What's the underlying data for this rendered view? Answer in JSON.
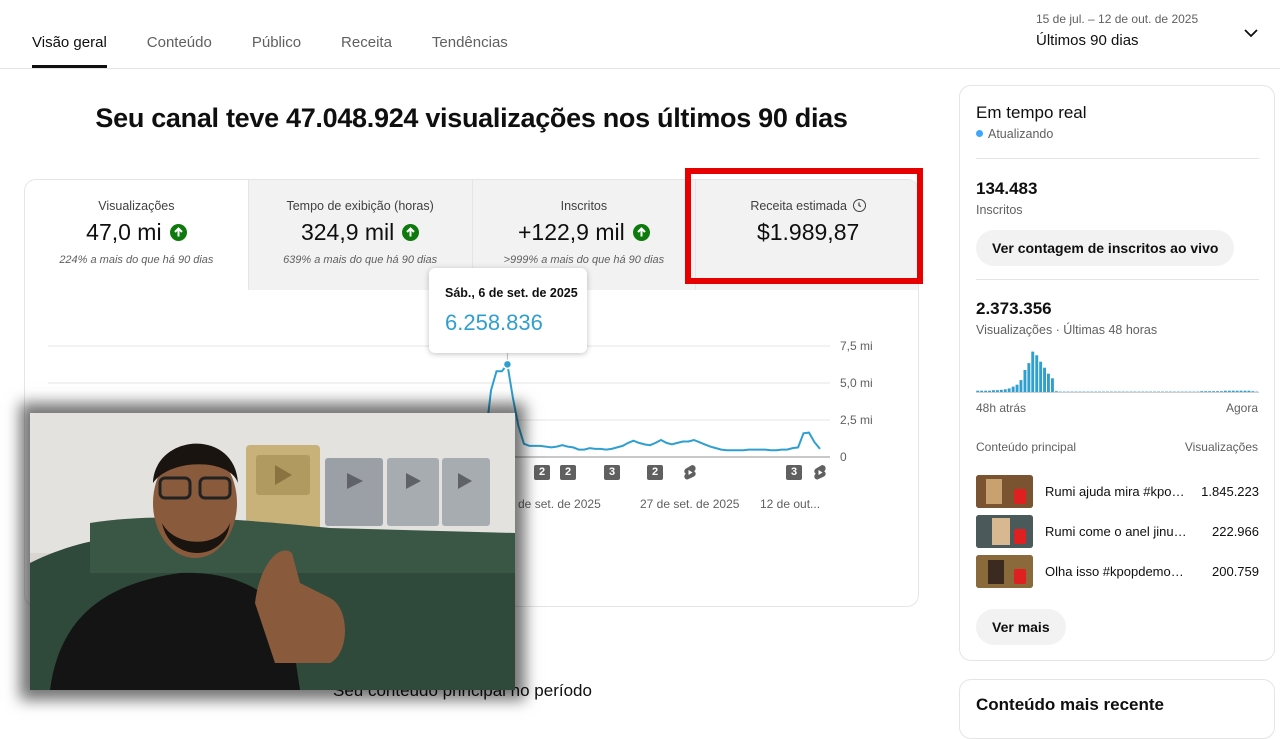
{
  "tabs": [
    "Visão geral",
    "Conteúdo",
    "Público",
    "Receita",
    "Tendências"
  ],
  "period": {
    "range": "15 de jul. – 12 de out. de 2025",
    "label": "Últimos 90 dias"
  },
  "headline": "Seu canal teve 47.048.924 visualizações nos últimos 90 dias",
  "metrics": [
    {
      "title": "Visualizações",
      "value": "47,0 mi",
      "comparison": "224% a mais do que há 90 dias"
    },
    {
      "title": "Tempo de exibição (horas)",
      "value": "324,9 mil",
      "comparison": "639% a mais do que há 90 dias"
    },
    {
      "title": "Inscritos",
      "value": "+122,9 mil",
      "comparison": ">999% a mais do que há 90 dias"
    },
    {
      "title": "Receita estimada",
      "value": "$1.989,87"
    }
  ],
  "tooltip": {
    "date": "Sáb., 6 de set. de 2025",
    "value": "6.258.836"
  },
  "chart_data": {
    "type": "line",
    "y_ticks": [
      "7,5 mi",
      "5,0 mi",
      "2,5 mi",
      "0"
    ],
    "ylim": [
      0,
      7.5
    ],
    "x_ticks": [
      "2 de set. de 2025",
      "27 de set. de 2025",
      "12 de out..."
    ],
    "series": [
      {
        "values": [
          0.3,
          1.3,
          4.5,
          5.8,
          5.8,
          6.26,
          4.0,
          2.1,
          0.9,
          0.75,
          0.75,
          0.75,
          0.7,
          0.65,
          0.7,
          0.8,
          0.7,
          0.65,
          0.5,
          0.5,
          0.6,
          0.55,
          0.55,
          0.5,
          0.55,
          0.65,
          0.75,
          0.95,
          1.1,
          0.95,
          0.85,
          0.8,
          0.95,
          1.15,
          0.95,
          0.85,
          0.95,
          1.05,
          1.05,
          1.15,
          1.0,
          0.85,
          0.7,
          0.6,
          0.5,
          0.45,
          0.45,
          0.45,
          0.45,
          0.5,
          0.5,
          0.5,
          0.5,
          0.45,
          0.45,
          0.5,
          0.5,
          0.6,
          0.65,
          1.6,
          1.65,
          1.0,
          0.55
        ]
      }
    ],
    "badges": [
      "2",
      "2",
      "3",
      "2",
      "3"
    ]
  },
  "section_title": "Seu conteúdo principal no período",
  "realtime": {
    "title": "Em tempo real",
    "status": "Atualizando",
    "subscribers_value": "134.483",
    "subscribers_label": "Inscritos",
    "live_button": "Ver contagem de inscritos ao vivo",
    "views_value": "2.373.356",
    "views_label": "Visualizações · Últimas 48 horas",
    "axis_start": "48h atrás",
    "axis_end": "Agora",
    "col_left": "Conteúdo principal",
    "col_right": "Visualizações",
    "bars": [
      0.05,
      0.05,
      0.05,
      0.05,
      0.06,
      0.06,
      0.07,
      0.08,
      0.1,
      0.14,
      0.18,
      0.28,
      0.5,
      0.65,
      0.9,
      0.82,
      0.68,
      0.55,
      0.42,
      0.32,
      0.04,
      0.03,
      0.03,
      0.03,
      0.03,
      0.03,
      0.03,
      0.03,
      0.03,
      0.03,
      0.03,
      0.03,
      0.03,
      0.03,
      0.03,
      0.03,
      0.03,
      0.03,
      0.03,
      0.03,
      0.03,
      0.03,
      0.03,
      0.03,
      0.03,
      0.03,
      0.03,
      0.03,
      0.03,
      0.03,
      0.03,
      0.03,
      0.03,
      0.03,
      0.03,
      0.03,
      0.03,
      0.04,
      0.04,
      0.04,
      0.04,
      0.04,
      0.04,
      0.05,
      0.05,
      0.05,
      0.05,
      0.05,
      0.05,
      0.05,
      0.04,
      0.03
    ],
    "items": [
      {
        "title": "Rumi ajuda mira #kpopdemo...",
        "views": "1.845.223"
      },
      {
        "title": "Rumi come o anel jinu #kpop...",
        "views": "222.966"
      },
      {
        "title": "Olha isso #kpopdemonhunte...",
        "views": "200.759"
      }
    ],
    "more_button": "Ver mais"
  },
  "recent": {
    "title": "Conteúdo mais recente"
  }
}
